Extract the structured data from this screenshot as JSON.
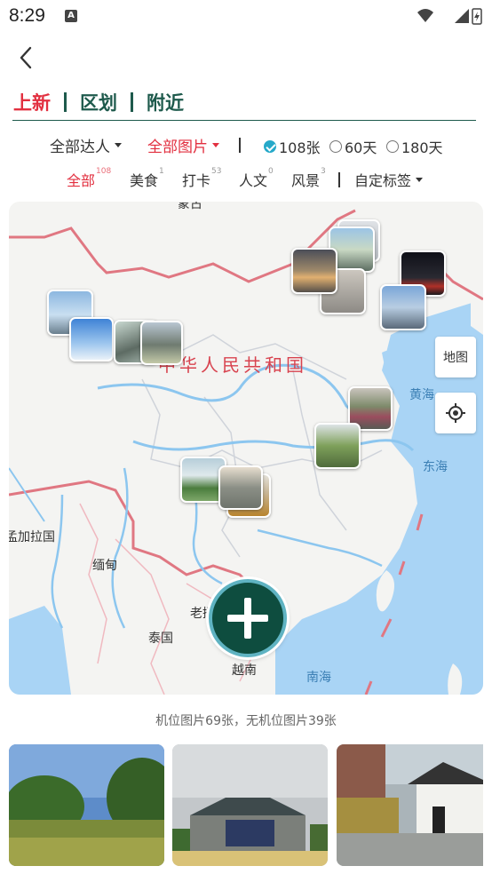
{
  "status": {
    "time": "8:29",
    "notification": "A"
  },
  "tabs": [
    {
      "label": "上新",
      "active": true
    },
    {
      "label": "区划",
      "active": false
    },
    {
      "label": "附近",
      "active": false
    }
  ],
  "filters": {
    "experts": "全部达人",
    "images": "全部图片",
    "count_108": "108张",
    "days_60": "60天",
    "days_180": "180天",
    "selected": "108张"
  },
  "tags": {
    "all": {
      "label": "全部",
      "count": "108"
    },
    "food": {
      "label": "美食",
      "count": "1"
    },
    "checkin": {
      "label": "打卡",
      "count": "53"
    },
    "culture": {
      "label": "人文",
      "count": "0"
    },
    "scenery": {
      "label": "风景",
      "count": "3"
    },
    "custom": {
      "label": "自定标签"
    }
  },
  "map": {
    "country": "中华人民共和国",
    "labels": {
      "mongolia": "蒙古",
      "bangladesh": "孟加拉国",
      "myanmar": "缅甸",
      "laos": "老挝",
      "thailand": "泰国",
      "vietnam": "越南",
      "yellow_sea": "黄海",
      "east_sea": "东海",
      "south_sea": "南海"
    },
    "map_button": "地图"
  },
  "summary": "机位图片69张，无机位图片39张",
  "colors": {
    "accent": "#e23040",
    "brand_green": "#1e5a4c",
    "check": "#26a9c9"
  }
}
